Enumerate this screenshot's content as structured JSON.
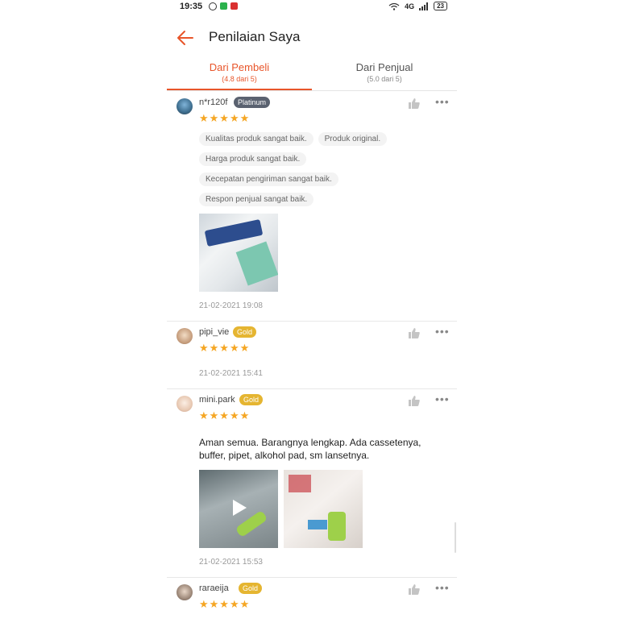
{
  "status_bar": {
    "time": "19:35",
    "network": "4G",
    "battery": "23"
  },
  "header": {
    "title": "Penilaian Saya"
  },
  "tabs": [
    {
      "label": "Dari Pembeli",
      "sub": "(4.8 dari 5)",
      "active": true
    },
    {
      "label": "Dari Penjual",
      "sub": "(5.0 dari 5)",
      "active": false
    }
  ],
  "reviews": [
    {
      "username": "n*r120f",
      "badge": "Platinum",
      "stars": "★★★★★",
      "rating": 5,
      "tags": [
        "Kualitas produk sangat baik.",
        "Produk original.",
        "Harga produk sangat baik.",
        "Kecepatan pengiriman sangat baik.",
        "Respon penjual sangat baik."
      ],
      "date": "21-02-2021 19:08"
    },
    {
      "username": "pipi_vie",
      "badge": "Gold",
      "stars": "★★★★★",
      "rating": 5,
      "date": "21-02-2021 15:41"
    },
    {
      "username": "mini.park",
      "badge": "Gold",
      "stars": "★★★★★",
      "rating": 5,
      "text": "Aman semua. Barangnya lengkap. Ada cassetenya, buffer, pipet, alkohol pad, sm lansetnya.",
      "date": "21-02-2021 15:53"
    },
    {
      "username": "raraeija",
      "badge": "Gold",
      "stars": "★★★★★",
      "rating": 5
    }
  ],
  "colors": {
    "accent": "#e8552a",
    "star": "#f5a623",
    "platinum": "#5a6270",
    "gold": "#e5b531"
  },
  "icons": [
    "back-arrow-icon",
    "thumbs-up-icon",
    "more-options-icon",
    "play-icon",
    "wifi-icon",
    "signal-icon",
    "battery-icon"
  ]
}
